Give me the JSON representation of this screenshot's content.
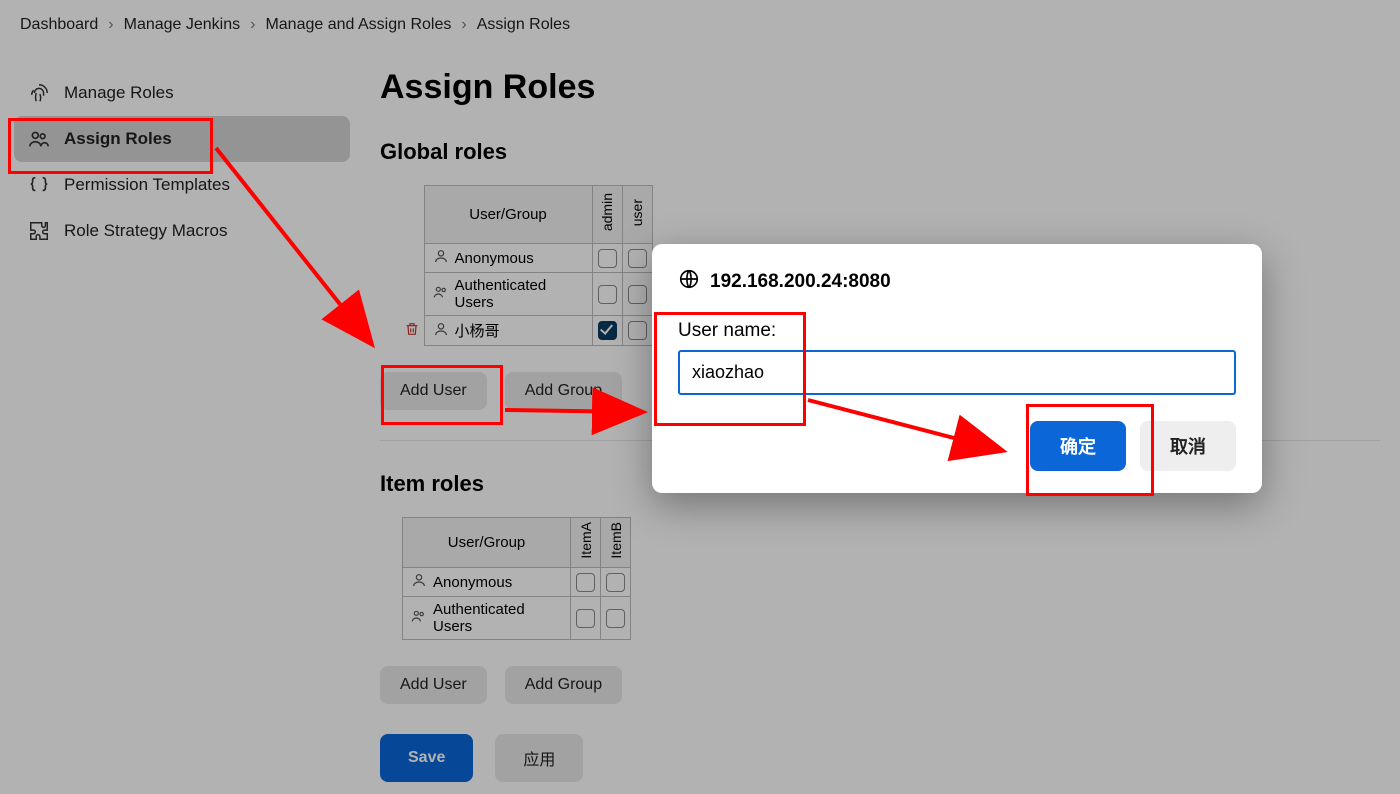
{
  "breadcrumbs": [
    "Dashboard",
    "Manage Jenkins",
    "Manage and Assign Roles",
    "Assign Roles"
  ],
  "sidebar": {
    "items": [
      {
        "label": "Manage Roles",
        "icon": "fingerprint-icon",
        "active": false
      },
      {
        "label": "Assign Roles",
        "icon": "users-icon",
        "active": true
      },
      {
        "label": "Permission Templates",
        "icon": "braces-icon",
        "active": false
      },
      {
        "label": "Role Strategy Macros",
        "icon": "puzzle-icon",
        "active": false
      }
    ]
  },
  "page": {
    "title": "Assign Roles",
    "global_section": {
      "heading": "Global roles",
      "user_group_header": "User/Group",
      "roles": [
        "admin",
        "user"
      ],
      "rows": [
        {
          "name": "Anonymous",
          "icon": "user",
          "deletable": false,
          "checks": [
            false,
            false
          ]
        },
        {
          "name": "Authenticated Users",
          "icon": "users",
          "deletable": false,
          "checks": [
            false,
            false
          ]
        },
        {
          "name": "小杨哥",
          "icon": "user",
          "deletable": true,
          "checks": [
            true,
            false
          ]
        }
      ],
      "add_user_label": "Add User",
      "add_group_label": "Add Group"
    },
    "item_section": {
      "heading": "Item roles",
      "user_group_header": "User/Group",
      "roles": [
        "ItemA",
        "ItemB"
      ],
      "rows": [
        {
          "name": "Anonymous",
          "icon": "user",
          "checks": [
            false,
            false
          ]
        },
        {
          "name": "Authenticated Users",
          "icon": "users",
          "checks": [
            false,
            false
          ]
        }
      ],
      "add_user_label": "Add User",
      "add_group_label": "Add Group"
    },
    "footer": {
      "save": "Save",
      "apply": "应用"
    }
  },
  "dialog": {
    "host": "192.168.200.24:8080",
    "label": "User name:",
    "value": "xiaozhao",
    "ok": "确定",
    "cancel": "取消"
  }
}
